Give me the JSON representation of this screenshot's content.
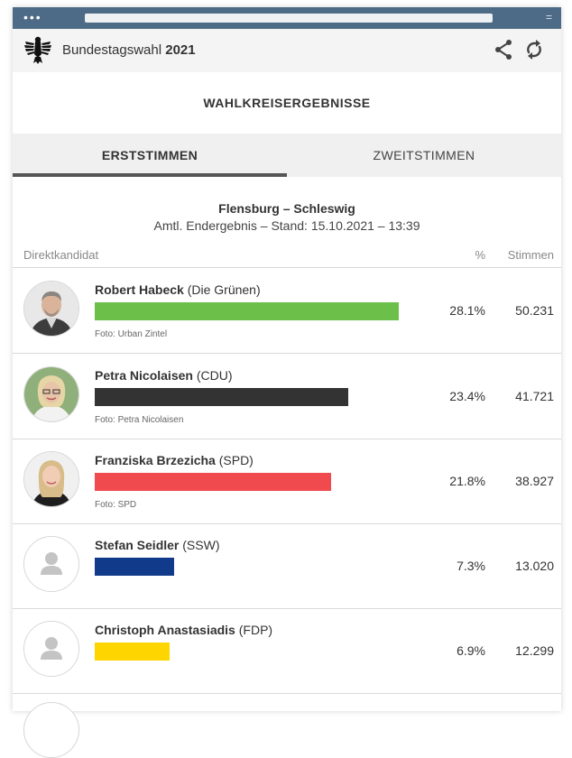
{
  "chrome": {
    "dots": "•••",
    "menu": "="
  },
  "header": {
    "app_name": "Bundestagswahl",
    "year": "2021"
  },
  "section_title": "WAHLKREISERGEBNISSE",
  "tabs": [
    {
      "label": "ERSTSTIMMEN",
      "active": true
    },
    {
      "label": "ZWEITSTIMMEN",
      "active": false
    }
  ],
  "district": {
    "name": "Flensburg – Schleswig",
    "status": "Amtl. Endergebnis – Stand: 15.10.2021 – 13:39"
  },
  "columns": {
    "candidate": "Direktkandidat",
    "percent": "%",
    "votes": "Stimmen"
  },
  "candidates": [
    {
      "name": "Robert Habeck",
      "party": " (Die Grünen)",
      "percent": "28.1%",
      "votes": "50.231",
      "share": 28.1,
      "color": "#6cc04a",
      "photo_credit": "Foto: Urban Zintel",
      "avatar": "photo-man"
    },
    {
      "name": "Petra Nicolaisen",
      "party": " (CDU)",
      "percent": "23.4%",
      "votes": "41.721",
      "share": 23.4,
      "color": "#333333",
      "photo_credit": "Foto: Petra Nicolaisen",
      "avatar": "photo-woman-blonde"
    },
    {
      "name": "Franziska Brzezicha",
      "party": " (SPD)",
      "percent": "21.8%",
      "votes": "38.927",
      "share": 21.8,
      "color": "#f04a4f",
      "photo_credit": "Foto: SPD",
      "avatar": "photo-woman"
    },
    {
      "name": "Stefan Seidler",
      "party": " (SSW)",
      "percent": "7.3%",
      "votes": "13.020",
      "share": 7.3,
      "color": "#113a8a",
      "photo_credit": "",
      "avatar": "placeholder-person-icon"
    },
    {
      "name": "Christoph Anastasiadis",
      "party": " (FDP)",
      "percent": "6.9%",
      "votes": "12.299",
      "share": 6.9,
      "color": "#ffd500",
      "photo_credit": "",
      "avatar": "placeholder-person-icon"
    }
  ]
}
